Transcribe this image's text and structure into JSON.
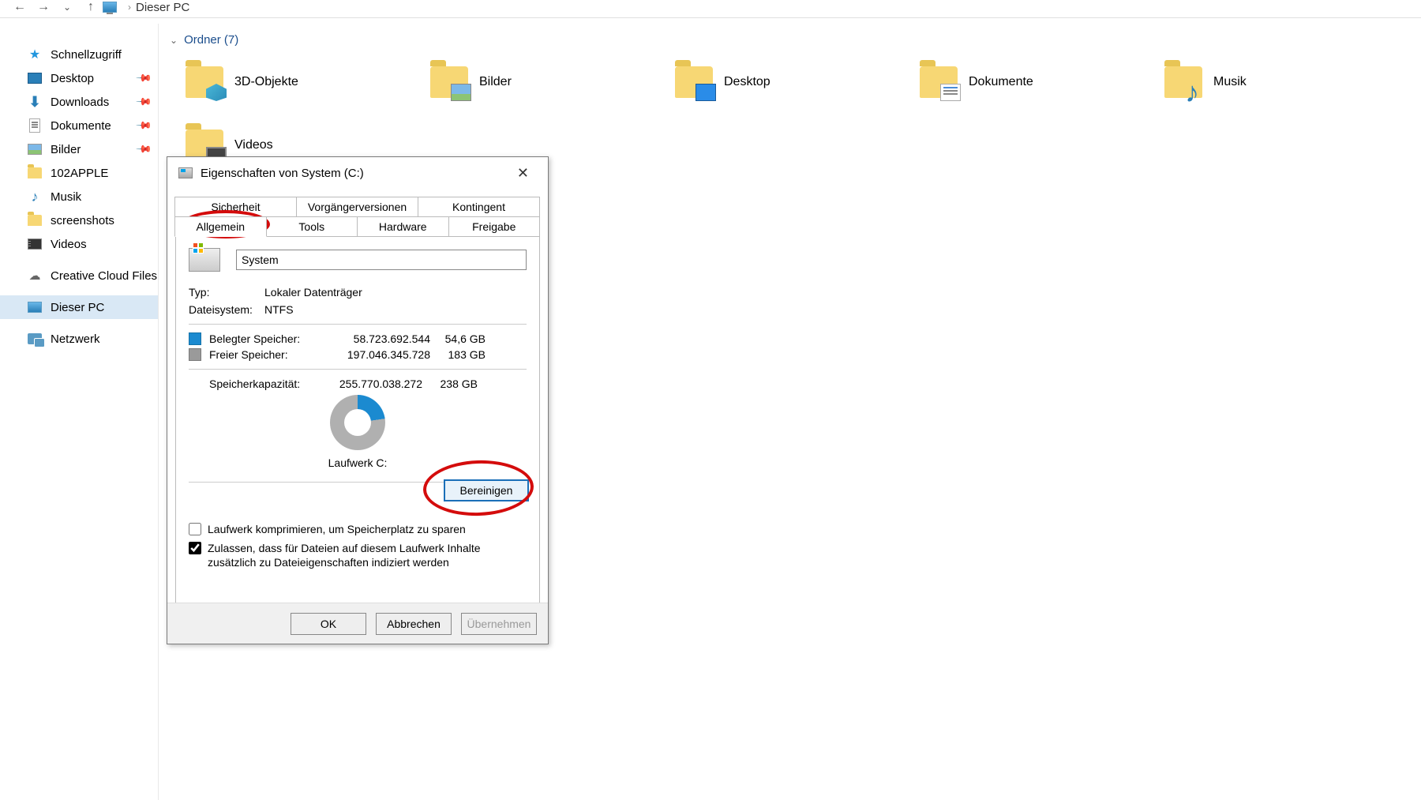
{
  "topbar": {
    "breadcrumb": "Dieser PC"
  },
  "sidebar": {
    "quick_access": "Schnellzugriff",
    "pinned": [
      {
        "label": "Desktop"
      },
      {
        "label": "Downloads"
      },
      {
        "label": "Dokumente"
      },
      {
        "label": "Bilder"
      }
    ],
    "recent": [
      {
        "label": "102APPLE"
      },
      {
        "label": "Musik"
      },
      {
        "label": "screenshots"
      },
      {
        "label": "Videos"
      }
    ],
    "creative_cloud": "Creative Cloud Files",
    "this_pc": "Dieser PC",
    "network": "Netzwerk"
  },
  "content": {
    "section_header": "Ordner (7)",
    "folders": [
      {
        "label": "3D-Objekte"
      },
      {
        "label": "Bilder"
      },
      {
        "label": "Desktop"
      },
      {
        "label": "Dokumente"
      },
      {
        "label": "Musik"
      },
      {
        "label": "Videos"
      }
    ]
  },
  "dialog": {
    "title": "Eigenschaften von System (C:)",
    "tabs_top": [
      "Sicherheit",
      "Vorgängerversionen",
      "Kontingent"
    ],
    "tabs_bottom": [
      "Allgemein",
      "Tools",
      "Hardware",
      "Freigabe"
    ],
    "drive_name": "System",
    "type_label": "Typ:",
    "type_value": "Lokaler Datenträger",
    "fs_label": "Dateisystem:",
    "fs_value": "NTFS",
    "used_label": "Belegter Speicher:",
    "used_bytes": "58.723.692.544",
    "used_gb": "54,6 GB",
    "free_label": "Freier Speicher:",
    "free_bytes": "197.046.345.728",
    "free_gb": "183 GB",
    "cap_label": "Speicherkapazität:",
    "cap_bytes": "255.770.038.272",
    "cap_gb": "238 GB",
    "drive_letter": "Laufwerk C:",
    "cleanup": "Bereinigen",
    "compress": "Laufwerk komprimieren, um Speicherplatz zu sparen",
    "index": "Zulassen, dass für Dateien auf diesem Laufwerk Inhalte zusätzlich zu Dateieigenschaften indiziert werden",
    "ok": "OK",
    "cancel": "Abbrechen",
    "apply": "Übernehmen"
  }
}
